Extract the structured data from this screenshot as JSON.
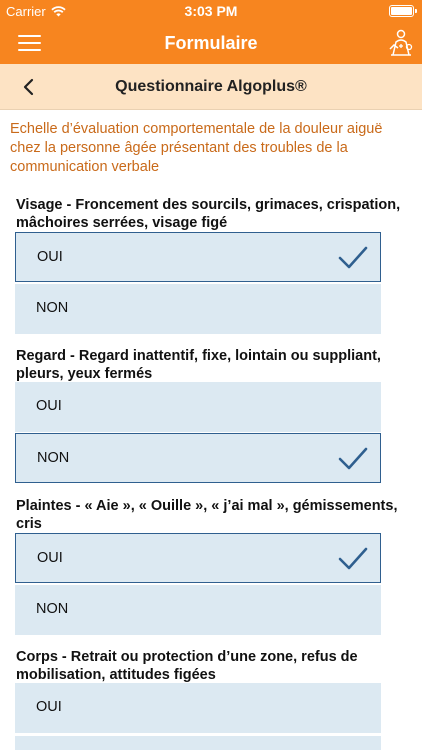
{
  "status_bar": {
    "carrier": "Carrier",
    "time": "3:03 PM"
  },
  "nav": {
    "title": "Formulaire"
  },
  "sub_header": {
    "title": "Questionnaire Algoplus®"
  },
  "intro": "Echelle d’évaluation comportementale de la douleur aiguë chez la personne âgée présentant des troubles de la communication verbale",
  "questions": [
    {
      "label": "Visage - Froncement des sourcils, grimaces, crispation, mâchoires serrées, visage figé",
      "options": [
        {
          "label": "OUI",
          "selected": true
        },
        {
          "label": "NON",
          "selected": false
        }
      ]
    },
    {
      "label": "Regard - Regard inattentif, fixe, lointain ou suppliant, pleurs, yeux fermés",
      "options": [
        {
          "label": "OUI",
          "selected": false
        },
        {
          "label": "NON",
          "selected": true
        }
      ]
    },
    {
      "label": "Plaintes - « Aie », « Ouille », « j’ai mal », gémissements, cris",
      "options": [
        {
          "label": "OUI",
          "selected": true
        },
        {
          "label": "NON",
          "selected": false
        }
      ]
    },
    {
      "label": "Corps - Retrait ou protection d’une zone, refus de mobilisation, attitudes figées",
      "options": [
        {
          "label": "OUI",
          "selected": false
        }
      ]
    }
  ],
  "colors": {
    "accent": "#f7851f",
    "subheader_bg": "#fde3c4",
    "intro_text": "#c96a1a",
    "option_bg": "#dce9f2",
    "check": "#2f5f8f"
  },
  "icons": {
    "menu": "hamburger-icon",
    "pro": "caregiver-icon",
    "back": "chevron-left-icon",
    "check": "checkmark-icon",
    "wifi": "wifi-icon",
    "battery": "battery-icon"
  }
}
